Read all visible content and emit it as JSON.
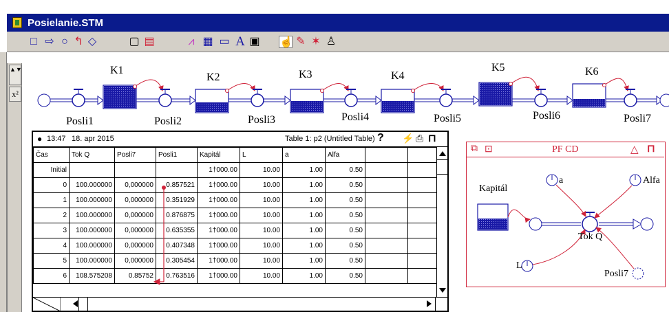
{
  "window": {
    "title": "Posielanie.STM"
  },
  "toolbar": {
    "tools": [
      {
        "name": "stock-tool-icon",
        "glyph": "□"
      },
      {
        "name": "flow-tool-icon",
        "glyph": "⇨"
      },
      {
        "name": "converter-tool-icon",
        "glyph": "○"
      },
      {
        "name": "connector-tool-icon",
        "glyph": "↰"
      },
      {
        "name": "decision-tool-icon",
        "glyph": "◇"
      },
      {
        "name": "module-tool-icon",
        "glyph": "▢"
      },
      {
        "name": "sector-tool-icon",
        "glyph": "▤"
      },
      {
        "name": "graph-tool-icon",
        "glyph": "⩘"
      },
      {
        "name": "table-tool-icon",
        "glyph": "▦"
      },
      {
        "name": "numeric-display-icon",
        "glyph": "▭"
      },
      {
        "name": "text-tool-icon",
        "glyph": "A"
      },
      {
        "name": "picture-tool-icon",
        "glyph": "▣"
      },
      {
        "name": "hand-tool-icon",
        "glyph": "☝"
      },
      {
        "name": "paintbrush-tool-icon",
        "glyph": "✎"
      },
      {
        "name": "dynamite-tool-icon",
        "glyph": "✶"
      },
      {
        "name": "ghost-tool-icon",
        "glyph": "♙"
      }
    ]
  },
  "side": {
    "zoom_label": "▲▼",
    "chi_label": "x²"
  },
  "model": {
    "stocks": [
      "K1",
      "K2",
      "K3",
      "K4",
      "K5",
      "K6"
    ],
    "flows": [
      "Posli1",
      "Posli2",
      "Posli3",
      "Posli4",
      "Posli5",
      "Posli6",
      "Posli7"
    ],
    "stock_levels": [
      1.0,
      0.45,
      0.5,
      0.5,
      1.0,
      0.35
    ]
  },
  "table_window": {
    "time": "13:47",
    "date": "18. apr 2015",
    "title": "Table 1: p2 (Untitled Table)",
    "help": "?",
    "columns": [
      "Čas",
      "Tok Q",
      "Posli7",
      "Posli1",
      "Kapitál",
      "L",
      "a",
      "Alfa",
      "",
      ""
    ],
    "rows": [
      [
        "Initial",
        "",
        "",
        "",
        "1†000.00",
        "10.00",
        "1.00",
        "0.50",
        "",
        ""
      ],
      [
        "0",
        "100.000000",
        "0,000000",
        "0.857521",
        "1†000.00",
        "10.00",
        "1.00",
        "0.50",
        "",
        ""
      ],
      [
        "1",
        "100.000000",
        "0,000000",
        "0.351929",
        "1†000.00",
        "10.00",
        "1.00",
        "0.50",
        "",
        ""
      ],
      [
        "2",
        "100.000000",
        "0,000000",
        "0.876875",
        "1†000.00",
        "10.00",
        "1.00",
        "0.50",
        "",
        ""
      ],
      [
        "3",
        "100.000000",
        "0,000000",
        "0.635355",
        "1†000.00",
        "10.00",
        "1.00",
        "0.50",
        "",
        ""
      ],
      [
        "4",
        "100.000000",
        "0,000000",
        "0.407348",
        "1†000.00",
        "10.00",
        "1.00",
        "0.50",
        "",
        ""
      ],
      [
        "5",
        "100.000000",
        "0,000000",
        "0.305454",
        "1†000.00",
        "10.00",
        "1.00",
        "0.50",
        "",
        ""
      ],
      [
        "6",
        "108.575208",
        "0.85752",
        "0.763516",
        "1†000.00",
        "10.00",
        "1.00",
        "0.50",
        "",
        ""
      ]
    ]
  },
  "pf_window": {
    "title": "PF CD",
    "stock_label": "Kapitál",
    "stock_level": 0.45,
    "flow_label": "Tok Q",
    "converters": [
      "a",
      "Alfa",
      "L",
      "Posli7"
    ]
  },
  "colors": {
    "title_bar": "#0a1b8c",
    "model_blue": "#1a1aa6",
    "accent_red": "#d0243a",
    "toolbar_gray": "#d4d0c8"
  }
}
